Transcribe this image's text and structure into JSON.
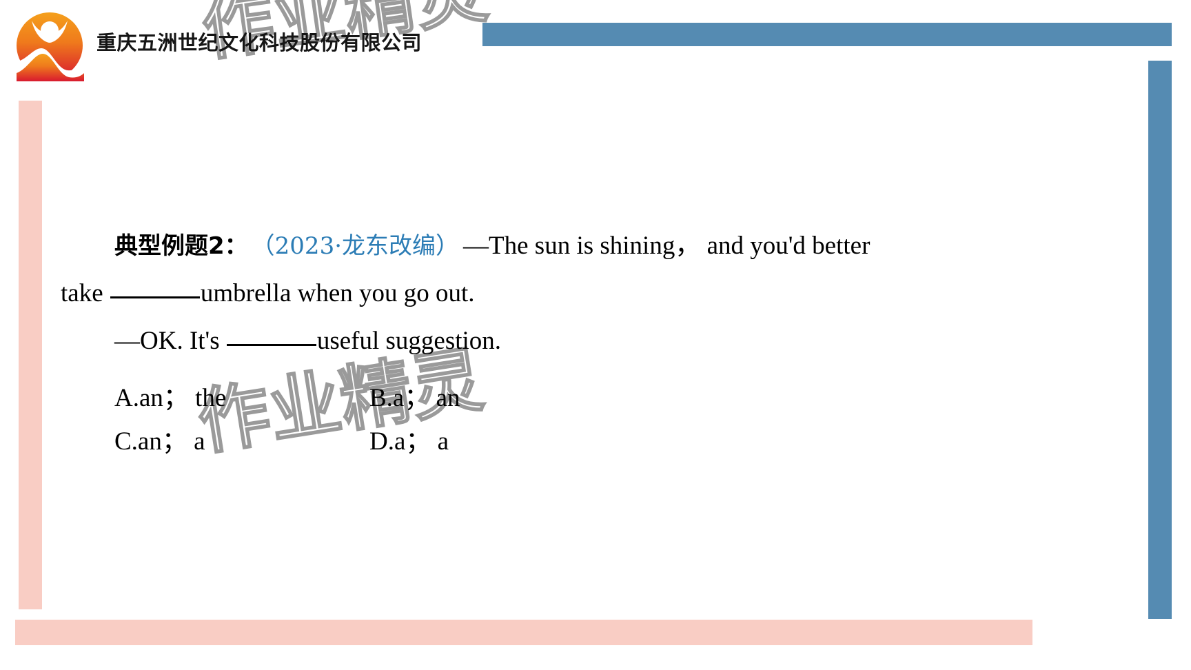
{
  "header": {
    "company_name": "重庆五洲世纪文化科技股份有限公司",
    "logo_icon": "sun-mountain-logo-icon"
  },
  "watermark": {
    "text": "作业精灵"
  },
  "colors": {
    "accent_blue": "#558bb2",
    "accent_pink": "#f9cdc4",
    "source_blue": "#2b7cb5",
    "logo_orange": "#f08a1e",
    "logo_red": "#d8192f"
  },
  "question": {
    "label": "典型例题2：",
    "source": "（2023·龙东改编）",
    "line1_en": "—The sun is shining，  and you'd better",
    "line2_pre": "take ",
    "line2_post": "umbrella when you go out.",
    "line3_pre": "—OK. It's ",
    "line3_post": "useful suggestion.",
    "options": [
      {
        "key": "A",
        "text": "A.an；  the"
      },
      {
        "key": "B",
        "text": "B.a；   an"
      },
      {
        "key": "C",
        "text": "C.an；  a"
      },
      {
        "key": "D",
        "text": "D.a；   a"
      }
    ]
  }
}
